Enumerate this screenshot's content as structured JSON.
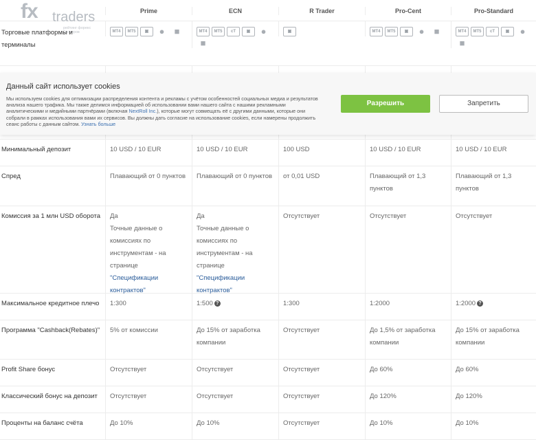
{
  "logo": {
    "fx": "fx",
    "traders": "traders",
    "tagline": "рейтинг форекс брокеров"
  },
  "columns": [
    "Prime",
    "ECN",
    "R Trader",
    "Pro-Cent",
    "Pro-Standard"
  ],
  "platforms": {
    "label": "Торговые платформы и терминалы",
    "icons": [
      [
        "MT4",
        "MT5",
        "web-icon",
        "apple-icon",
        "android-icon"
      ],
      [
        "MT4",
        "MT5",
        "cT",
        "web-icon",
        "apple-icon",
        "android-icon"
      ],
      [
        "web-icon"
      ],
      [
        "MT4",
        "MT5",
        "web-icon",
        "apple-icon",
        "android-icon"
      ],
      [
        "MT4",
        "MT5",
        "cT",
        "web-icon",
        "apple-icon",
        "android-icon"
      ]
    ]
  },
  "cookie": {
    "title": "Данный сайт использует cookies",
    "text_before": "Мы используем cookies для оптимизации распределения контента и рекламы с учётом особенностей социальных медиа и результатов анализа нашего трафика. Мы также делимся информацией об использовании вами нашего сайта с нашими рекламными аналитическими и медийными партнёрами (включая ",
    "text_link": "NextRoll Inc.",
    "text_after": "), которые могут совмещать её с другими данными, которые они собрали в рамках использования вами их сервисов. Вы должны дать согласие на использование cookies, если намерены продолжить сеанс работы с данным сайтом. ",
    "more_link": "Узнать больше",
    "allow": "Разрешить",
    "deny": "Запретить"
  },
  "rows": [
    {
      "label": "Минимальный депозит",
      "values": [
        "10 USD / 10 EUR",
        "10 USD / 10 EUR",
        "100 USD",
        "10 USD / 10 EUR",
        "10 USD / 10 EUR"
      ]
    },
    {
      "label": "Спред",
      "values": [
        "Плавающий от 0 пунктов",
        "Плавающий от 0 пунктов",
        "от 0,01 USD",
        "Плавающий от 1,3 пунктов",
        "Плавающий от 1,3 пунктов"
      ]
    },
    {
      "label": "Комиссия за 1 млн USD оборота",
      "values": [
        "Да",
        "Да",
        "Отсутствует",
        "Отсутствует",
        "Отсутствует"
      ],
      "note_before": "Точные данные о комиссиях по инструментам - на странице ",
      "note_link": "\"Спецификации контрактов\""
    },
    {
      "label": "Максимальное кредитное плечо",
      "values": [
        "1:300",
        "1:500",
        "1:300",
        "1:2000",
        "1:2000"
      ]
    },
    {
      "label": "Программа \"Cashback(Rebates)\"",
      "values": [
        "5% от комиссии",
        "До 15% от заработка компании",
        "Отсутствует",
        "До 1,5% от заработка компании",
        "До 15% от заработка компании"
      ]
    },
    {
      "label": "Profit Share бонус",
      "values": [
        "Отсутствует",
        "Отсутствует",
        "Отсутствует",
        "До 60%",
        "До 60%"
      ]
    },
    {
      "label": "Классический бонус на депозит",
      "values": [
        "Отсутствует",
        "Отсутствует",
        "Отсутствует",
        "До 120%",
        "До 120%"
      ]
    },
    {
      "label": "Проценты на баланс счёта",
      "values": [
        "До 10%",
        "До 10%",
        "Отсутствует",
        "До 10%",
        "До 10%"
      ]
    }
  ]
}
